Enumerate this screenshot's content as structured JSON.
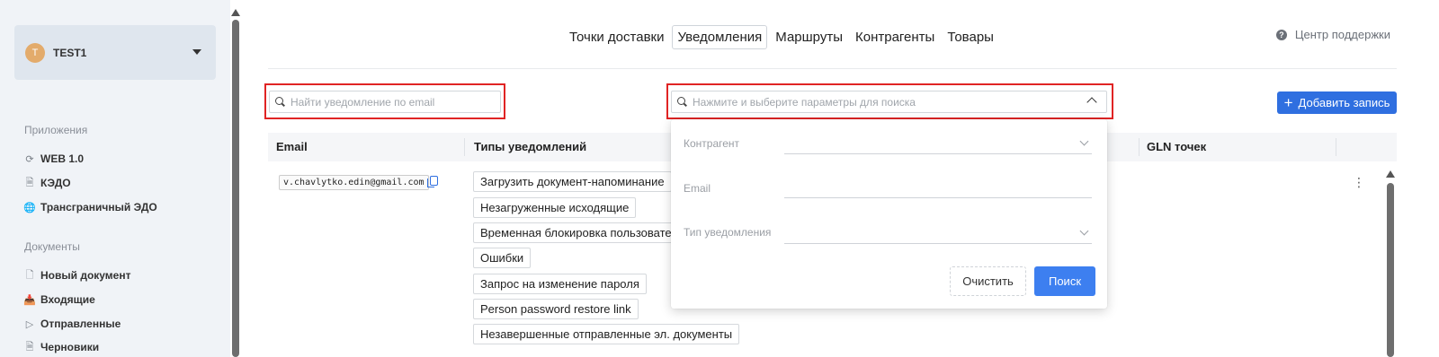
{
  "account": {
    "initial": "T",
    "name": "TEST1"
  },
  "sidebar": {
    "sections": [
      {
        "title": "Приложения",
        "items": [
          {
            "label": "WEB 1.0",
            "icon": "sync-icon"
          },
          {
            "label": "КЭДО",
            "icon": "document-icon"
          },
          {
            "label": "Трансграничный ЭДО",
            "icon": "globe-icon"
          }
        ]
      },
      {
        "title": "Документы",
        "items": [
          {
            "label": "Новый документ",
            "icon": "new-document-icon"
          },
          {
            "label": "Входящие",
            "icon": "inbox-icon"
          },
          {
            "label": "Отправленные",
            "icon": "send-icon"
          },
          {
            "label": "Черновики",
            "icon": "draft-icon"
          }
        ]
      }
    ]
  },
  "topnav": {
    "tabs": [
      {
        "label": "Точки доставки",
        "active": false
      },
      {
        "label": "Уведомления",
        "active": true
      },
      {
        "label": "Маршруты",
        "active": false
      },
      {
        "label": "Контрагенты",
        "active": false
      },
      {
        "label": "Товары",
        "active": false
      }
    ],
    "support_label": "Центр поддержки"
  },
  "search": {
    "email_placeholder": "Найти уведомление по email",
    "params_placeholder": "Нажмите и выберите параметры для поиска"
  },
  "toolbar": {
    "add_label": "Добавить запись"
  },
  "table": {
    "headers": {
      "email": "Email",
      "types": "Типы уведомлений",
      "gln": "GLN точек"
    },
    "rows": [
      {
        "email": "v.chavlytko.edin@gmail.com",
        "types": [
          "Загрузить документ-напоминание",
          "Незагруженные исходящие",
          "Временная блокировка пользователя",
          "Ошибки",
          "Запрос на изменение пароля",
          "Person password restore link",
          "Незавершенные отправленные эл. документы"
        ]
      }
    ]
  },
  "filter_panel": {
    "fields": {
      "counterparty": "Контрагент",
      "email": "Email",
      "notification_type": "Тип уведомления"
    },
    "clear_label": "Очистить",
    "search_label": "Поиск"
  },
  "colors": {
    "accent": "#2f6fe0",
    "highlight": "#e02424",
    "avatar": "#e3ab6b"
  }
}
